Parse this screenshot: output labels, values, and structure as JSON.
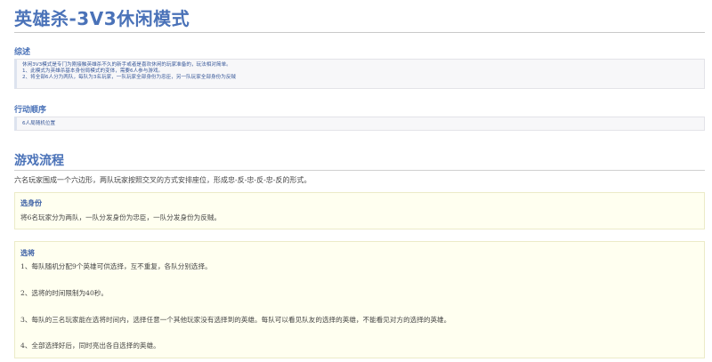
{
  "title": "英雄杀-3V3休闲模式",
  "sections": {
    "summary": {
      "heading": "综述",
      "lines": [
        "休闲3V3模式是专门为刚接触英雄杀不久的新手或者是喜欢休闲的玩家准备的，玩法相对简单。",
        "1、此模式为英雄杀基本身份局模式的变体，需要6人参与游戏。",
        "2、将全部6人分为两队，每队为3名玩家，一队玩家全部身份为忠臣，另一队玩家全部身份为反贼"
      ]
    },
    "order": {
      "heading": "行动顺序",
      "lines": [
        "6人局随机位置"
      ]
    },
    "flow": {
      "heading": "游戏流程",
      "intro": "六名玩家围成一个六边形，两队玩家按照交叉的方式安排座位，形成忠-反-忠-反-忠-反的形式。",
      "identity": {
        "title": "选身份",
        "text": "将6名玩家分为两队，一队分发身份为忠臣，一队分发身份为反贼。"
      },
      "pick": {
        "title": "选将",
        "items": [
          "1、每队随机分配9个英雄可供选择，互不重复，各队分别选择。",
          "2、选将的时间限制为40秒。",
          "3、每队的三名玩家能在选将时间内，选择任意一个其他玩家没有选择到的英雄。每队可以看见队友的选择的英雄，不能看见对方的选择的英雄。",
          "4、全部选择好后，同时亮出各自选择的英雄。"
        ]
      }
    }
  }
}
